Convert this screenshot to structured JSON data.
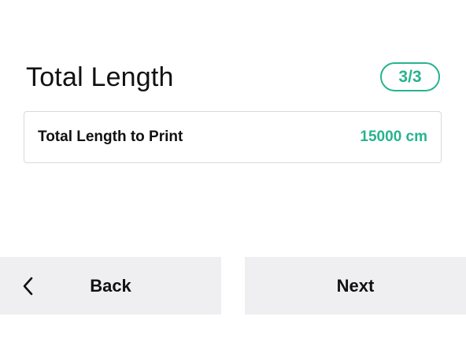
{
  "header": {
    "title": "Total Length",
    "step_badge": "3/3"
  },
  "info_card": {
    "label": "Total Length to Print",
    "value": "15000 cm"
  },
  "footer": {
    "back_label": "Back",
    "next_label": "Next"
  },
  "icons": {
    "back": "chevron-left-icon"
  },
  "colors": {
    "accent": "#27b38f",
    "button_bg": "#efeff1",
    "text": "#111111",
    "card_border": "#d9d9d9"
  }
}
